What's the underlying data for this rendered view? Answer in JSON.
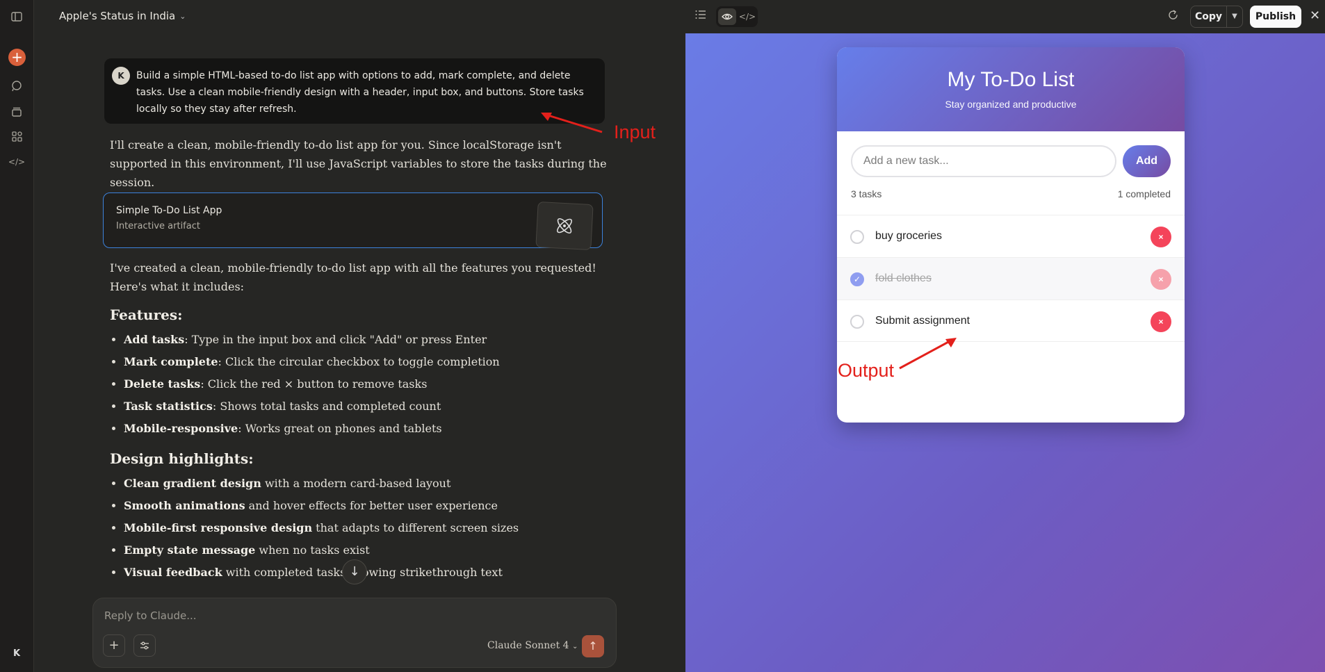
{
  "chat": {
    "title": "Apple's Status in India",
    "user_initial": "K",
    "user_message": "Build a simple HTML-based to-do list app with options to add, mark complete, and delete tasks. Use a clean mobile-friendly design with a header, input box, and buttons. Store tasks locally so they stay after refresh.",
    "reply_intro": "I'll create a clean, mobile-friendly to-do list app for you. Since localStorage isn't supported in this environment, I'll use JavaScript variables to store the tasks during the session.",
    "artifact": {
      "title": "Simple To-Do List App",
      "subtitle": "Interactive artifact"
    },
    "reply_summary": "I've created a clean, mobile-friendly to-do list app with all the features you requested! Here's what it includes:",
    "features_heading": "Features:",
    "features": [
      {
        "bold": "Add tasks",
        "text": ": Type in the input box and click \"Add\" or press Enter"
      },
      {
        "bold": "Mark complete",
        "text": ": Click the circular checkbox to toggle completion"
      },
      {
        "bold": "Delete tasks",
        "text": ": Click the red × button to remove tasks"
      },
      {
        "bold": "Task statistics",
        "text": ": Shows total tasks and completed count"
      },
      {
        "bold": "Mobile-responsive",
        "text": ": Works great on phones and tablets"
      }
    ],
    "design_heading": "Design highlights:",
    "design": [
      {
        "bold": "Clean gradient design",
        "text": " with a modern card-based layout"
      },
      {
        "bold": "Smooth animations",
        "text": " and hover effects for better user experience"
      },
      {
        "bold": "Mobile-first responsive design",
        "text": " that adapts to different screen sizes"
      },
      {
        "bold": "Empty state message",
        "text": " when no tasks exist"
      },
      {
        "bold": "Visual feedback",
        "text": " with completed tasks showing strikethrough text"
      }
    ],
    "composer": {
      "placeholder": "Reply to Claude...",
      "model": "Claude Sonnet 4"
    }
  },
  "sidebar": {
    "user_initial": "K"
  },
  "toolbar": {
    "copy_label": "Copy",
    "publish_label": "Publish"
  },
  "todo_app": {
    "title": "My To-Do List",
    "subtitle": "Stay organized and productive",
    "input_placeholder": "Add a new task...",
    "add_label": "Add",
    "total_label": "3 tasks",
    "completed_label": "1 completed",
    "tasks": [
      {
        "text": "buy groceries",
        "done": false
      },
      {
        "text": "fold clothes",
        "done": true
      },
      {
        "text": "Submit assignment",
        "done": false
      }
    ],
    "delete_symbol": "×"
  },
  "annotations": {
    "input_label": "Input",
    "output_label": "Output",
    "color": "#e3201b"
  },
  "colors": {
    "accent_orange": "#d9603b",
    "artifact_border": "#3c82dc",
    "gradient_start": "#667eea",
    "gradient_end": "#764ba2",
    "delete_red": "#f4445a"
  }
}
